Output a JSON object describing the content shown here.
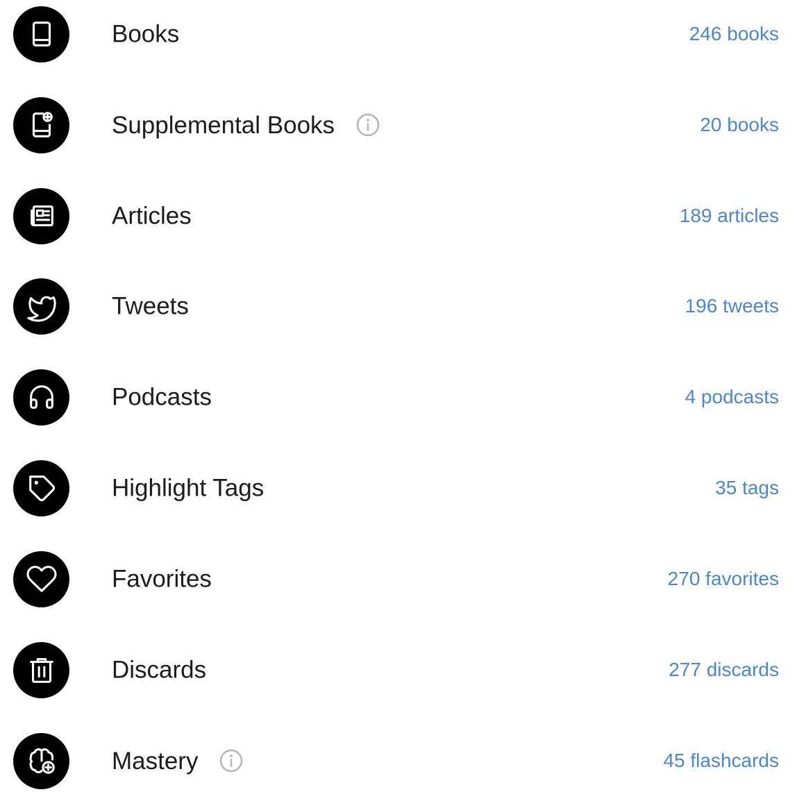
{
  "accent_color": "#4a86d4",
  "rows": [
    {
      "key": "books",
      "icon": "book-icon",
      "label": "Books",
      "has_info": false,
      "count": "246 books"
    },
    {
      "key": "supplemental-books",
      "icon": "supplemental-book-icon",
      "label": "Supplemental Books",
      "has_info": true,
      "count": "20 books"
    },
    {
      "key": "articles",
      "icon": "newspaper-icon",
      "label": "Articles",
      "has_info": false,
      "count": "189 articles"
    },
    {
      "key": "tweets",
      "icon": "twitter-bird-icon",
      "label": "Tweets",
      "has_info": false,
      "count": "196 tweets"
    },
    {
      "key": "podcasts",
      "icon": "headphones-icon",
      "label": "Podcasts",
      "has_info": false,
      "count": "4 podcasts"
    },
    {
      "key": "highlight-tags",
      "icon": "tag-icon",
      "label": "Highlight Tags",
      "has_info": false,
      "count": "35 tags"
    },
    {
      "key": "favorites",
      "icon": "heart-icon",
      "label": "Favorites",
      "has_info": false,
      "count": "270 favorites"
    },
    {
      "key": "discards",
      "icon": "trash-icon",
      "label": "Discards",
      "has_info": false,
      "count": "277 discards"
    },
    {
      "key": "mastery",
      "icon": "brain-plus-icon",
      "label": "Mastery",
      "has_info": true,
      "count": "45 flashcards"
    }
  ]
}
